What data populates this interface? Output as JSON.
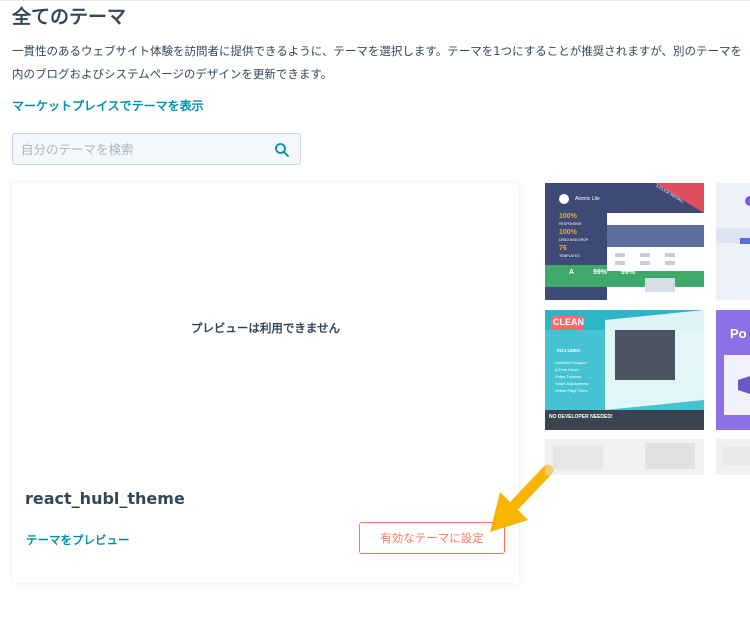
{
  "header": {
    "title": "全てのテーマ",
    "description_line1": "一貫性のあるウェブサイト体験を訪問者に提供できるように、テーマを選択します。テーマを1つにすることが推奨されますが、別のテーマを",
    "description_line2": "内のブログおよびシステムページのデザインを更新できます。",
    "marketplace_link": "マーケットプレイスでテーマを表示"
  },
  "search": {
    "placeholder": "自分のテーマを検索",
    "icon": "search-icon"
  },
  "theme_card": {
    "no_preview_text": "プレビューは利用できません",
    "theme_name": "react_hubl_theme",
    "preview_link": "テーマをプレビュー",
    "activate_button": "有効なテーマに設定"
  },
  "marketplace_thumbnails": {
    "thumb1": {
      "name": "Atomic Lite",
      "ribbon": "1-CLICK INSTALL",
      "stat1": "100%",
      "stat1_label": "RESPONSIVE",
      "stat2": "100%",
      "stat2_label": "DRAG AND DROP",
      "stat3": "76",
      "stat3_label": "TEMPLATES",
      "score_grade": "A",
      "score1": "99%",
      "score2": "99%"
    },
    "thumb3": {
      "name": "CLEAN",
      "includes": "INCLUDES",
      "feature1": "Unlimited Support",
      "feature2": "& Free Hours",
      "feature3": "Video Tutorials",
      "feature4": "Smart Adjustments",
      "feature5": "Virtual Page Tours",
      "footer": "NO DEVELOPER NEEDED!"
    },
    "thumb4": {
      "label": "Po"
    }
  },
  "colors": {
    "primary_text": "#33475b",
    "link": "#0091ae",
    "accent_orange": "#ff7a59",
    "arrow_yellow": "#f7b500"
  }
}
